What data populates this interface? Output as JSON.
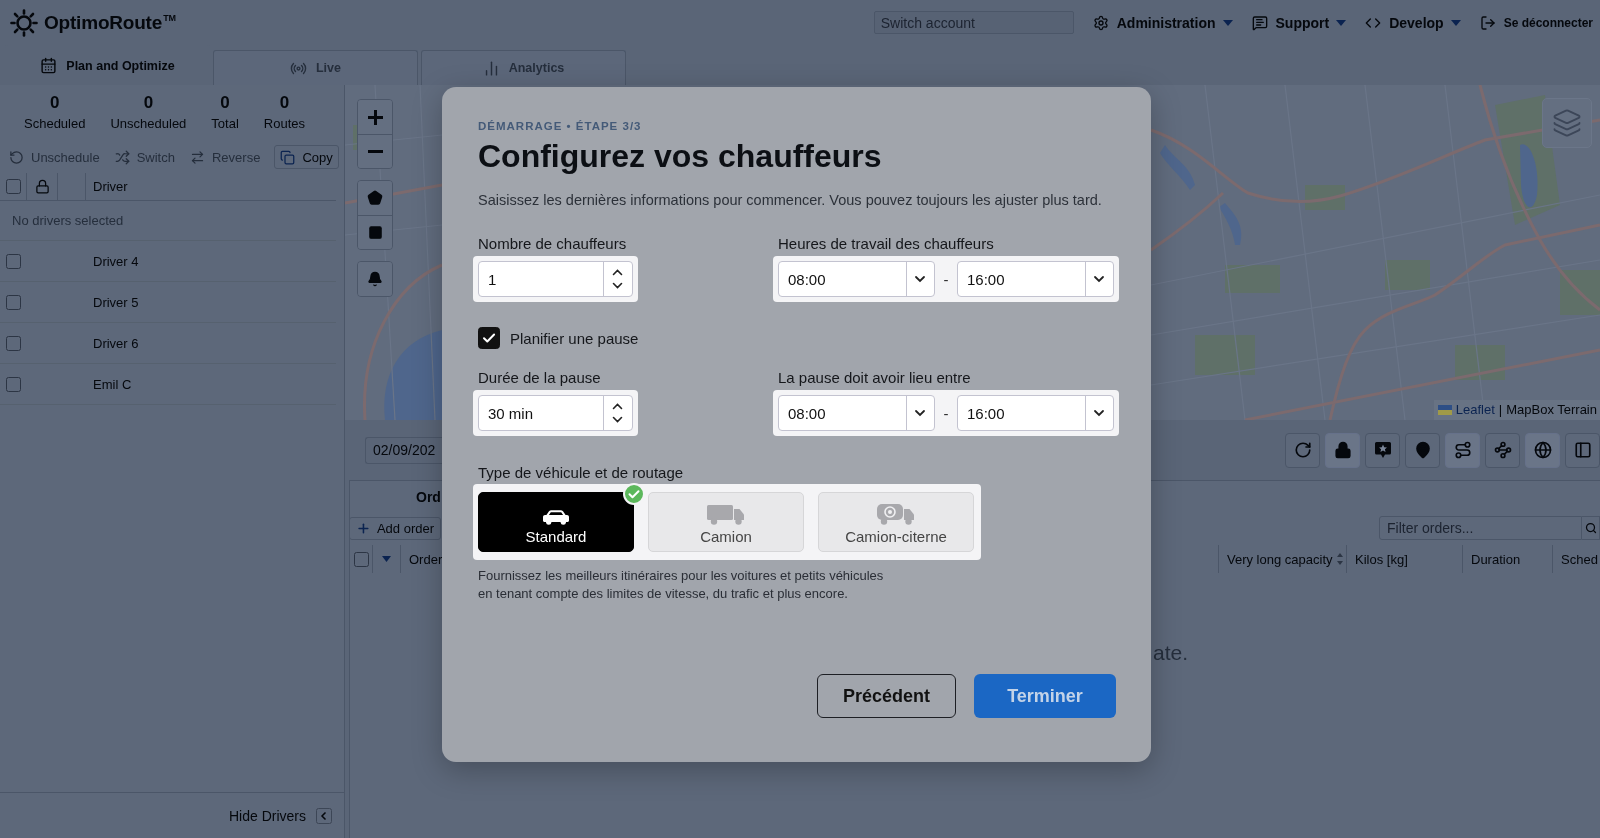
{
  "header": {
    "logo": {
      "name": "OptimoRoute",
      "mark": "TM"
    },
    "switch_account": {
      "placeholder": "Switch account"
    },
    "menu": [
      {
        "label": "Administration",
        "kind": "settings",
        "dropdown": true
      },
      {
        "label": "Support",
        "kind": "support",
        "dropdown": true
      },
      {
        "label": "Develop",
        "kind": "code",
        "dropdown": true
      },
      {
        "label": "Se déconnecter",
        "kind": "logout",
        "dropdown": false
      }
    ]
  },
  "nav_tabs": [
    {
      "label": "Plan and Optimize",
      "kind": "calendar",
      "selected": true
    },
    {
      "label": "Live",
      "kind": "broadcast",
      "selected": false
    },
    {
      "label": "Analytics",
      "kind": "bars",
      "selected": false
    }
  ],
  "drivers_panel": {
    "stats": [
      {
        "value": "0",
        "label": "Scheduled"
      },
      {
        "value": "0",
        "label": "Unscheduled"
      },
      {
        "value": "0",
        "label": "Total"
      },
      {
        "value": "0",
        "label": "Routes"
      }
    ],
    "actions": [
      {
        "label": "Unschedule",
        "kind": "unschedule",
        "disabled": true
      },
      {
        "label": "Switch",
        "kind": "switch",
        "disabled": true
      },
      {
        "label": "Reverse",
        "kind": "reverse",
        "disabled": true
      },
      {
        "label": "Copy",
        "kind": "copy",
        "disabled": false
      }
    ],
    "table": {
      "column": "Driver",
      "select_all_checked": false,
      "empty_message": "No drivers selected",
      "rows": [
        {
          "name": "Driver 4",
          "checked": false
        },
        {
          "name": "Driver 5",
          "checked": false
        },
        {
          "name": "Driver 6",
          "checked": false
        },
        {
          "name": "Emil C",
          "checked": false
        }
      ]
    },
    "hide_button": "Hide Drivers"
  },
  "map": {
    "attribution": {
      "link": "Leaflet",
      "separator": "|",
      "text": "MapBox Terrain"
    }
  },
  "map_toolbar": {
    "date": "02/09/202",
    "tools": [
      {
        "kind": "refresh",
        "active": false
      },
      {
        "kind": "lock",
        "active": true
      },
      {
        "kind": "star-bubble",
        "active": false
      },
      {
        "kind": "pin",
        "active": false
      },
      {
        "kind": "route",
        "active": true
      },
      {
        "kind": "waypoints",
        "active": false
      },
      {
        "kind": "globe",
        "active": true
      },
      {
        "kind": "panel",
        "active": false
      }
    ]
  },
  "orders": {
    "title": "Ord",
    "add_button": "Add order",
    "filter": {
      "placeholder": "Filter orders..."
    },
    "select_all_checked": false,
    "columns": [
      {
        "label": "Order",
        "sortable": false
      },
      {
        "label": "Very long capacity",
        "sortable": true
      },
      {
        "label": "Kilos [kg]",
        "sortable": false
      },
      {
        "label": "Duration",
        "sortable": false
      },
      {
        "label": "Sched"
      }
    ],
    "empty_message": "ate."
  },
  "dialog": {
    "step": "DÉMARRAGE • ÉTAPE 3/3",
    "title": "Configurez vos chauffeurs",
    "subtitle": "Saisissez les dernières informations pour commencer. Vous pouvez toujours les ajuster plus tard.",
    "driver_count": {
      "label": "Nombre de chauffeurs",
      "value": "1"
    },
    "working_hours": {
      "label": "Heures de travail des chauffeurs",
      "start": "08:00",
      "separator": "-",
      "end": "16:00"
    },
    "break_toggle": {
      "label": "Planifier une pause",
      "checked": true
    },
    "break_duration": {
      "label": "Durée de la pause",
      "value": "30 min"
    },
    "break_window": {
      "label": "La pause doit avoir lieu entre",
      "start": "08:00",
      "separator": "-",
      "end": "16:00"
    },
    "vehicle_type": {
      "label": "Type de véhicule et de routage",
      "options": [
        {
          "label": "Standard",
          "kind": "car",
          "selected": true
        },
        {
          "label": "Camion",
          "kind": "truck",
          "selected": false
        },
        {
          "label": "Camion-citerne",
          "kind": "tanker",
          "selected": false
        }
      ],
      "description": "Fournissez les meilleurs itinéraires pour les voitures et petits véhicules\nen tenant compte des limites de vitesse, du trafic et plus encore."
    },
    "buttons": [
      {
        "label": "Précédent",
        "kind": "secondary"
      },
      {
        "label": "Terminer",
        "kind": "primary"
      }
    ]
  }
}
